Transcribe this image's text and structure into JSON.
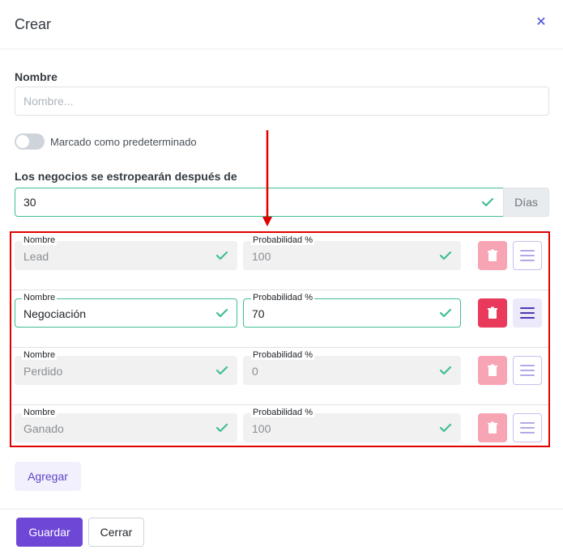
{
  "modal": {
    "title": "Crear",
    "close_icon": "close-icon"
  },
  "name_field": {
    "label": "Nombre",
    "placeholder": "Nombre...",
    "value": ""
  },
  "default_toggle": {
    "label": "Marcado como predeterminado",
    "checked": false
  },
  "rotting": {
    "label": "Los negocios se estropearán después de",
    "value": "30",
    "unit": "Días"
  },
  "stages": [
    {
      "name_label": "Nombre",
      "name": "Lead",
      "probability_label": "Probabilidad %",
      "probability": "100",
      "state": "disabled"
    },
    {
      "name_label": "Nombre",
      "name": "Negociación",
      "probability_label": "Probabilidad %",
      "probability": "70",
      "state": "active"
    },
    {
      "name_label": "Nombre",
      "name": "Perdido",
      "probability_label": "Probabilidad %",
      "probability": "0",
      "state": "disabled"
    },
    {
      "name_label": "Nombre",
      "name": "Ganado",
      "probability_label": "Probabilidad %",
      "probability": "100",
      "state": "disabled"
    }
  ],
  "actions": {
    "add_label": "Agregar",
    "save_label": "Guardar",
    "close_label": "Cerrar"
  },
  "colors": {
    "primary": "#6f47d6",
    "danger": "#e93a5c",
    "valid": "#3fbf8f",
    "annotation": "#e00000"
  }
}
